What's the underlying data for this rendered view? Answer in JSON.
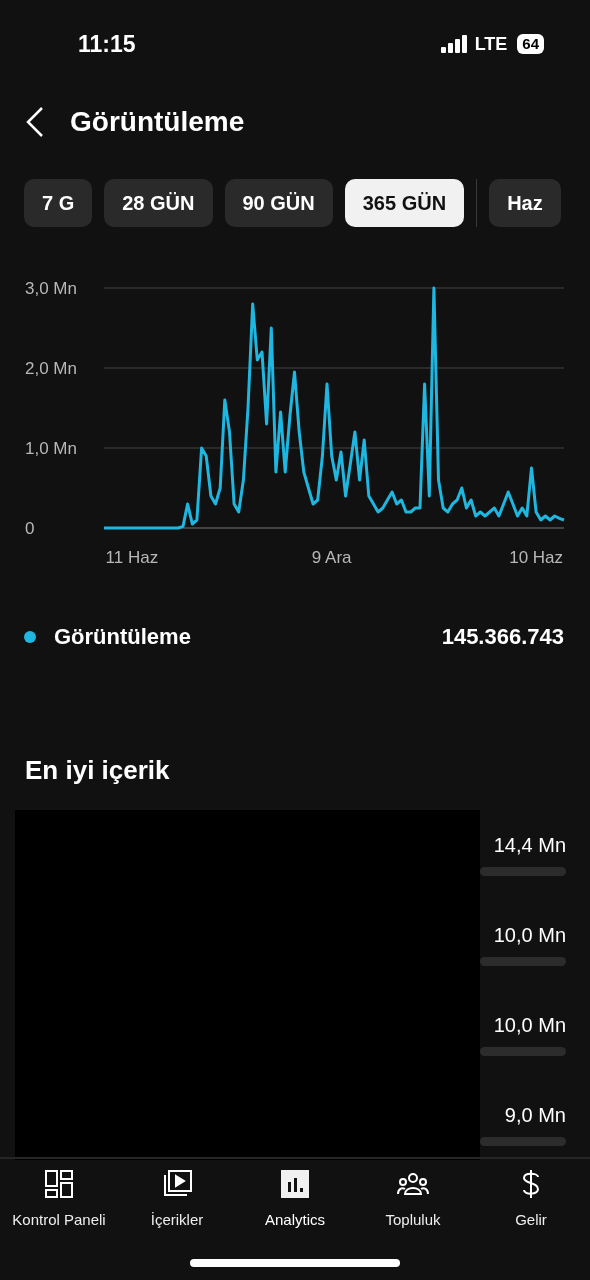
{
  "status_bar": {
    "time": "11:15",
    "network": "LTE",
    "battery": "64"
  },
  "header": {
    "title": "Görüntüleme"
  },
  "tabs": [
    {
      "label": "7 G",
      "selected": false
    },
    {
      "label": "28 GÜN",
      "selected": false
    },
    {
      "label": "90 GÜN",
      "selected": false
    },
    {
      "label": "365 GÜN",
      "selected": true
    },
    {
      "label": "Haz",
      "selected": false
    }
  ],
  "chart_data": {
    "type": "line",
    "yticks": [
      {
        "value": 0,
        "label": "0"
      },
      {
        "value": 1,
        "label": "1,0 Mn"
      },
      {
        "value": 2,
        "label": "2,0 Mn"
      },
      {
        "value": 3,
        "label": "3,0 Mn"
      }
    ],
    "ylim": [
      0,
      3
    ],
    "categories": [
      null,
      null,
      null,
      null,
      null,
      null,
      "11 Haz",
      null,
      null,
      null,
      null,
      null,
      null,
      null,
      null,
      null,
      null,
      null,
      null,
      null,
      null,
      null,
      null,
      null,
      null,
      null,
      null,
      null,
      null,
      null,
      null,
      null,
      null,
      null,
      null,
      null,
      null,
      null,
      null,
      null,
      null,
      null,
      null,
      null,
      null,
      null,
      null,
      null,
      null,
      "9 Ara",
      null,
      null,
      null,
      null,
      null,
      null,
      null,
      null,
      null,
      null,
      null,
      null,
      null,
      null,
      null,
      null,
      null,
      null,
      null,
      null,
      null,
      null,
      null,
      null,
      null,
      null,
      null,
      null,
      null,
      null,
      null,
      null,
      null,
      null,
      null,
      null,
      null,
      null,
      null,
      null,
      null,
      null,
      null,
      "10 Haz",
      null,
      null,
      null,
      null,
      null,
      null
    ],
    "series": [
      {
        "name": "Görüntüleme",
        "color": "#1fb6e0",
        "values": [
          0,
          0,
          0,
          0,
          0,
          0,
          0,
          0,
          0,
          0,
          0,
          0,
          0,
          0,
          0,
          0,
          0,
          0.02,
          0.3,
          0.05,
          0.1,
          1.0,
          0.9,
          0.4,
          0.3,
          0.5,
          1.6,
          1.2,
          0.3,
          0.2,
          0.6,
          1.5,
          2.8,
          2.1,
          2.2,
          1.3,
          2.5,
          0.7,
          1.45,
          0.7,
          1.4,
          1.95,
          1.2,
          0.7,
          0.5,
          0.3,
          0.35,
          0.9,
          1.8,
          0.9,
          0.6,
          0.95,
          0.4,
          0.8,
          1.2,
          0.6,
          1.1,
          0.4,
          0.3,
          0.2,
          0.25,
          0.35,
          0.45,
          0.3,
          0.35,
          0.2,
          0.2,
          0.25,
          0.25,
          1.8,
          0.4,
          3.0,
          0.6,
          0.25,
          0.2,
          0.3,
          0.35,
          0.5,
          0.25,
          0.35,
          0.15,
          0.2,
          0.15,
          0.2,
          0.25,
          0.15,
          0.3,
          0.45,
          0.3,
          0.15,
          0.25,
          0.15,
          0.75,
          0.2,
          0.1,
          0.15,
          0.1,
          0.15,
          0.12,
          0.1
        ]
      }
    ]
  },
  "legend": {
    "total": "145.366.743"
  },
  "top_content": {
    "title": "En iyi içerik",
    "items": [
      {
        "views": "14,4 Mn"
      },
      {
        "views": "10,0 Mn"
      },
      {
        "views": "10,0 Mn"
      },
      {
        "views": "9,0 Mn"
      }
    ]
  },
  "bottom_nav": [
    {
      "label": "Kontrol Paneli",
      "kind": "dashboard",
      "selected": false
    },
    {
      "label": "İçerikler",
      "kind": "content",
      "selected": false
    },
    {
      "label": "Analytics",
      "kind": "analytics",
      "selected": true
    },
    {
      "label": "Topluluk",
      "kind": "community",
      "selected": false
    },
    {
      "label": "Gelir",
      "kind": "revenue",
      "selected": false
    }
  ]
}
